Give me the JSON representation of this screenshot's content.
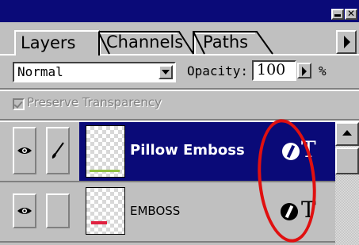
{
  "window": {
    "minimize_glyph": "▁",
    "close_glyph": "✕"
  },
  "tabs": [
    {
      "label": "Layers",
      "active": true
    },
    {
      "label": "Channels",
      "active": false
    },
    {
      "label": "Paths",
      "active": false
    }
  ],
  "blend_mode": {
    "value": "Normal"
  },
  "opacity": {
    "label": "Opacity:",
    "value": "100",
    "unit": "%"
  },
  "preserve_transparency": {
    "label": "Preserve Transparency",
    "checked": true,
    "enabled": false
  },
  "layers": [
    {
      "name": "Pillow Emboss",
      "selected": true,
      "visible": true,
      "brush": true,
      "thumb_mark_color": "#90c040"
    },
    {
      "name": "EMBOSS",
      "selected": false,
      "visible": true,
      "brush": false,
      "thumb_mark_color": "#e02040"
    }
  ],
  "colors": {
    "title_bar": "#0a0a78",
    "selection": "#0a0a78",
    "panel": "#c0c0c0",
    "annotation": "#e01010"
  },
  "icons": {
    "visibility": "eye-icon",
    "paint": "brush-icon",
    "effects": "layer-effects-icon",
    "type": "text-layer-icon",
    "menu": "panel-menu-arrow-icon"
  }
}
